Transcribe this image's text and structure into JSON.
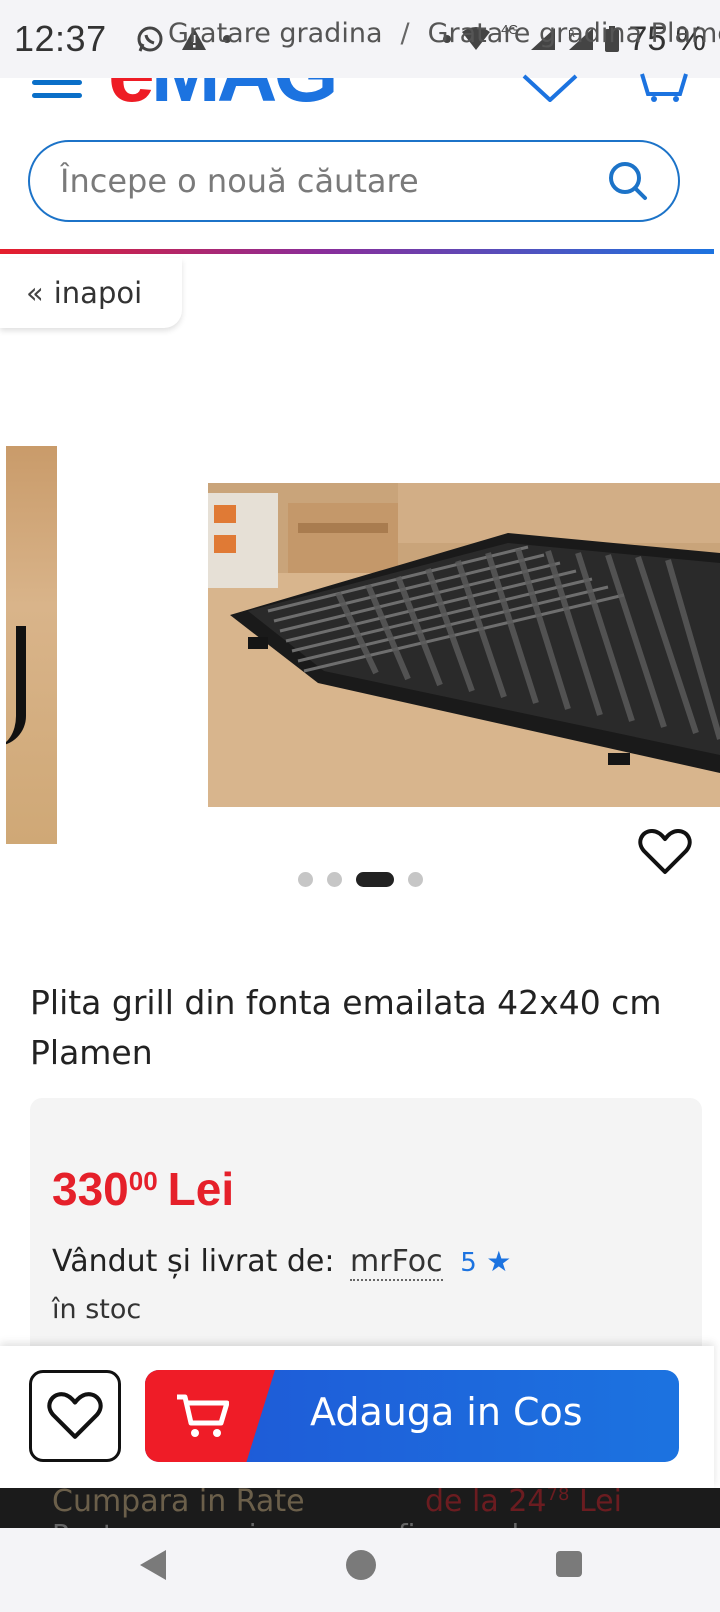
{
  "status_bar": {
    "time": "12:37",
    "battery": "75 %",
    "network": "4G"
  },
  "header": {
    "logo": {
      "e": "e",
      "mag": "MAG"
    }
  },
  "search": {
    "placeholder": "Începe o nouă căutare"
  },
  "breadcrumb": {
    "back": "inapoi",
    "back_prefix": "«",
    "items": [
      "Gratare gradina",
      "Gratare gradina Plamen"
    ],
    "separator": "/"
  },
  "gallery": {
    "dots_total": 4,
    "active_index": 2
  },
  "product": {
    "title": "Plita grill din fonta emailata 42x40 cm Plamen",
    "price": {
      "integer": "330",
      "decimals": "00",
      "currency": "Lei"
    },
    "seller": {
      "label": "Vândut și livrat de:",
      "name": "mrFoc",
      "rating": "5"
    },
    "stock": "în stoc"
  },
  "actions": {
    "add_to_cart": "Adauga in Cos"
  },
  "installments": {
    "label": "Cumpara in Rate",
    "value_prefix": "de la",
    "value_int": "24",
    "value_dec": "78",
    "currency": "Lei",
    "note": "Pentru acapuri precum afisarea de"
  },
  "colors": {
    "brand_red": "#e5202a",
    "brand_blue": "#1c73e0"
  }
}
